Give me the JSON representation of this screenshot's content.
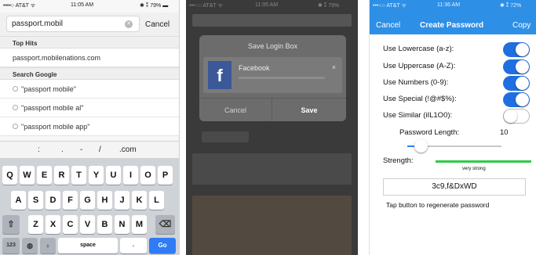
{
  "search_screen": {
    "status": {
      "carrier": "••••○ AT&T ᯤ",
      "time": "11:05 AM",
      "battery": "✱ ⁑ 79% ▬"
    },
    "search": {
      "value": "passport.mobil",
      "cancel_label": "Cancel"
    },
    "top_hits": {
      "header": "Top Hits",
      "items": [
        "passport.mobilenations.com"
      ]
    },
    "search_google": {
      "header": "Search Google",
      "items": [
        "\"passport mobile\"",
        "\"passport mobile al\"",
        "\"passport mobile app\""
      ]
    },
    "punctuation": [
      ":",
      ".",
      "-",
      "/",
      ".com"
    ],
    "keyboard": {
      "row1": [
        "Q",
        "W",
        "E",
        "R",
        "T",
        "Y",
        "U",
        "I",
        "O",
        "P"
      ],
      "row2": [
        "A",
        "S",
        "D",
        "F",
        "G",
        "H",
        "J",
        "K",
        "L"
      ],
      "row3": [
        "Z",
        "X",
        "C",
        "V",
        "B",
        "N",
        "M"
      ],
      "numbers_key": "123",
      "space_key": "space",
      "dot_key": ".",
      "go_key": "Go"
    }
  },
  "save_dialog": {
    "status": {
      "carrier": "•••○○ AT&T ᯤ",
      "time": "11:05 AM",
      "battery": "✱ ⁑ 79%"
    },
    "title": "Save Login Box",
    "site_name": "Facebook",
    "close_glyph": "×",
    "cancel_label": "Cancel",
    "save_label": "Save",
    "facebook_blue": "#3b5998"
  },
  "generator": {
    "status": {
      "carrier": "•••○○ AT&T ᯤ",
      "time": "11:36 AM",
      "battery": "✱ ⁑ 72%"
    },
    "header": {
      "cancel_label": "Cancel",
      "title": "Create Password",
      "copy_label": "Copy",
      "color": "#2e8fe6"
    },
    "options": [
      {
        "label": "Use Lowercase (a-z):",
        "on": true
      },
      {
        "label": "Use Uppercase (A-Z):",
        "on": true
      },
      {
        "label": "Use Numbers (0-9):",
        "on": true
      },
      {
        "label": "Use Special (!@#$%):",
        "on": true
      },
      {
        "label": "Use Similar (iIL1O0):",
        "on": false
      }
    ],
    "length_label": "Password Length:",
    "length_value": "10",
    "length_slider_fraction": 0.14,
    "strength_label": "Strength:",
    "strength_text": "very strong",
    "strength_fraction": 1.0,
    "strength_color": "#2ecc40",
    "password": "3c9,f&DxWD",
    "hint": "Tap button to regenerate password"
  }
}
